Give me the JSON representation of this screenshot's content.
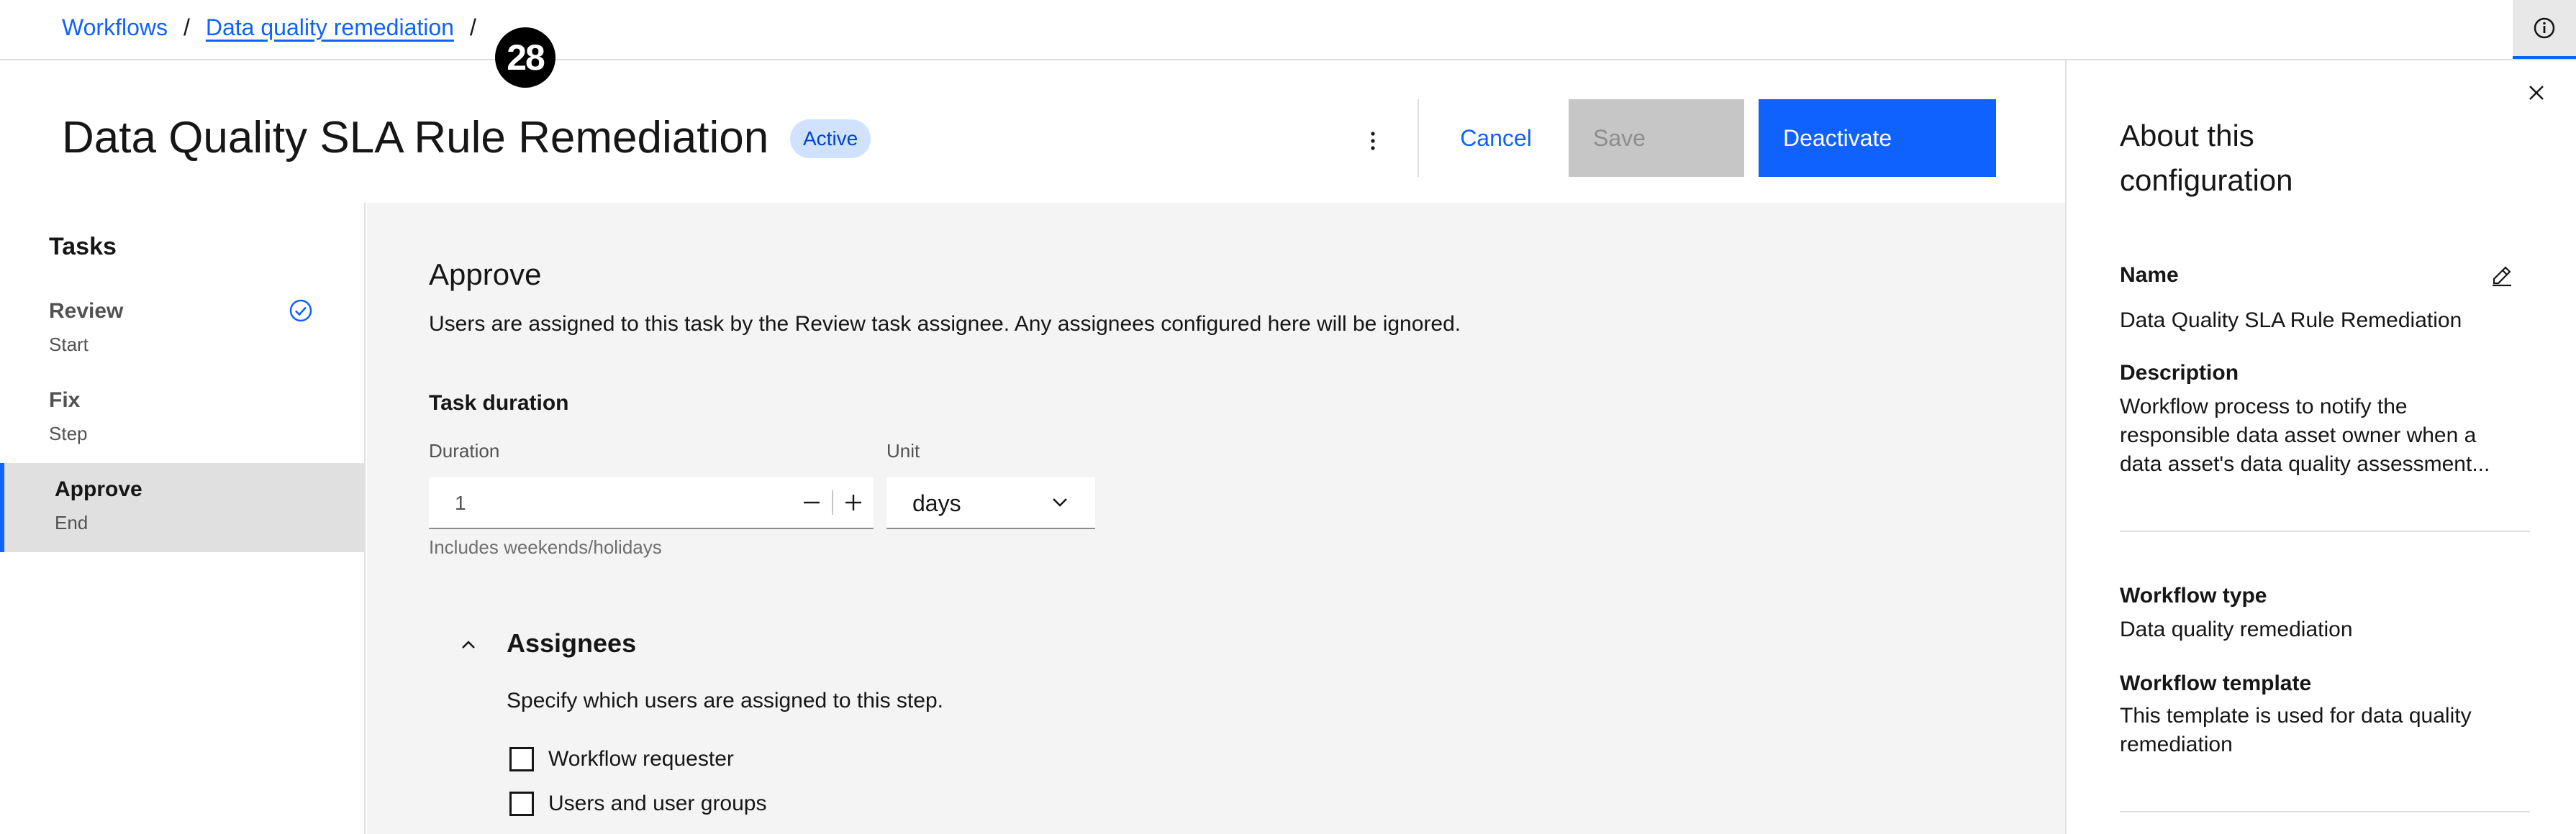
{
  "breadcrumb": {
    "items": [
      "Workflows",
      "Data quality remediation"
    ],
    "separator": "/"
  },
  "overlay_badge": "28",
  "header": {
    "title": "Data Quality SLA Rule Remediation",
    "status": "Active",
    "cancel_label": "Cancel",
    "save_label": "Save",
    "deactivate_label": "Deactivate"
  },
  "tasks": {
    "title": "Tasks",
    "items": [
      {
        "label": "Review",
        "sub": "Start",
        "completed": true
      },
      {
        "label": "Fix",
        "sub": "Step",
        "completed": false
      },
      {
        "label": "Approve",
        "sub": "End",
        "selected": true
      }
    ]
  },
  "main": {
    "section_title": "Approve",
    "description": "Users are assigned to this task by the Review task assignee. Any assignees configured here will be ignored.",
    "duration_heading": "Task duration",
    "duration_label": "Duration",
    "duration_value": "1",
    "unit_label": "Unit",
    "unit_value": "days",
    "helper": "Includes weekends/holidays",
    "assignees_title": "Assignees",
    "assignees_desc": "Specify which users are assigned to this step.",
    "checkboxes": [
      "Workflow requester",
      "Users and user groups"
    ]
  },
  "panel": {
    "title": "About this configuration",
    "name_label": "Name",
    "name_value": "Data Quality SLA Rule Remediation",
    "description_label": "Description",
    "description_value": "Workflow process to notify the responsible data asset owner when a data asset's data quality assessment...",
    "type_label": "Workflow type",
    "type_value": "Data quality remediation",
    "template_label": "Workflow template",
    "template_value": "This template is used for data quality remediation"
  },
  "icons": {
    "info": "info-icon",
    "overflow": "overflow-menu-icon",
    "check": "checkmark-outline-icon",
    "chevron_down": "chevron-down-icon",
    "chevron_up": "chevron-up-icon",
    "close": "close-icon",
    "edit": "edit-icon"
  },
  "colors": {
    "primary": "#0f62fe",
    "tag_bg": "#d0e2ff",
    "tag_text": "#0043ce",
    "disabled_bg": "#c6c6c6",
    "content_bg": "#f4f4f4"
  }
}
